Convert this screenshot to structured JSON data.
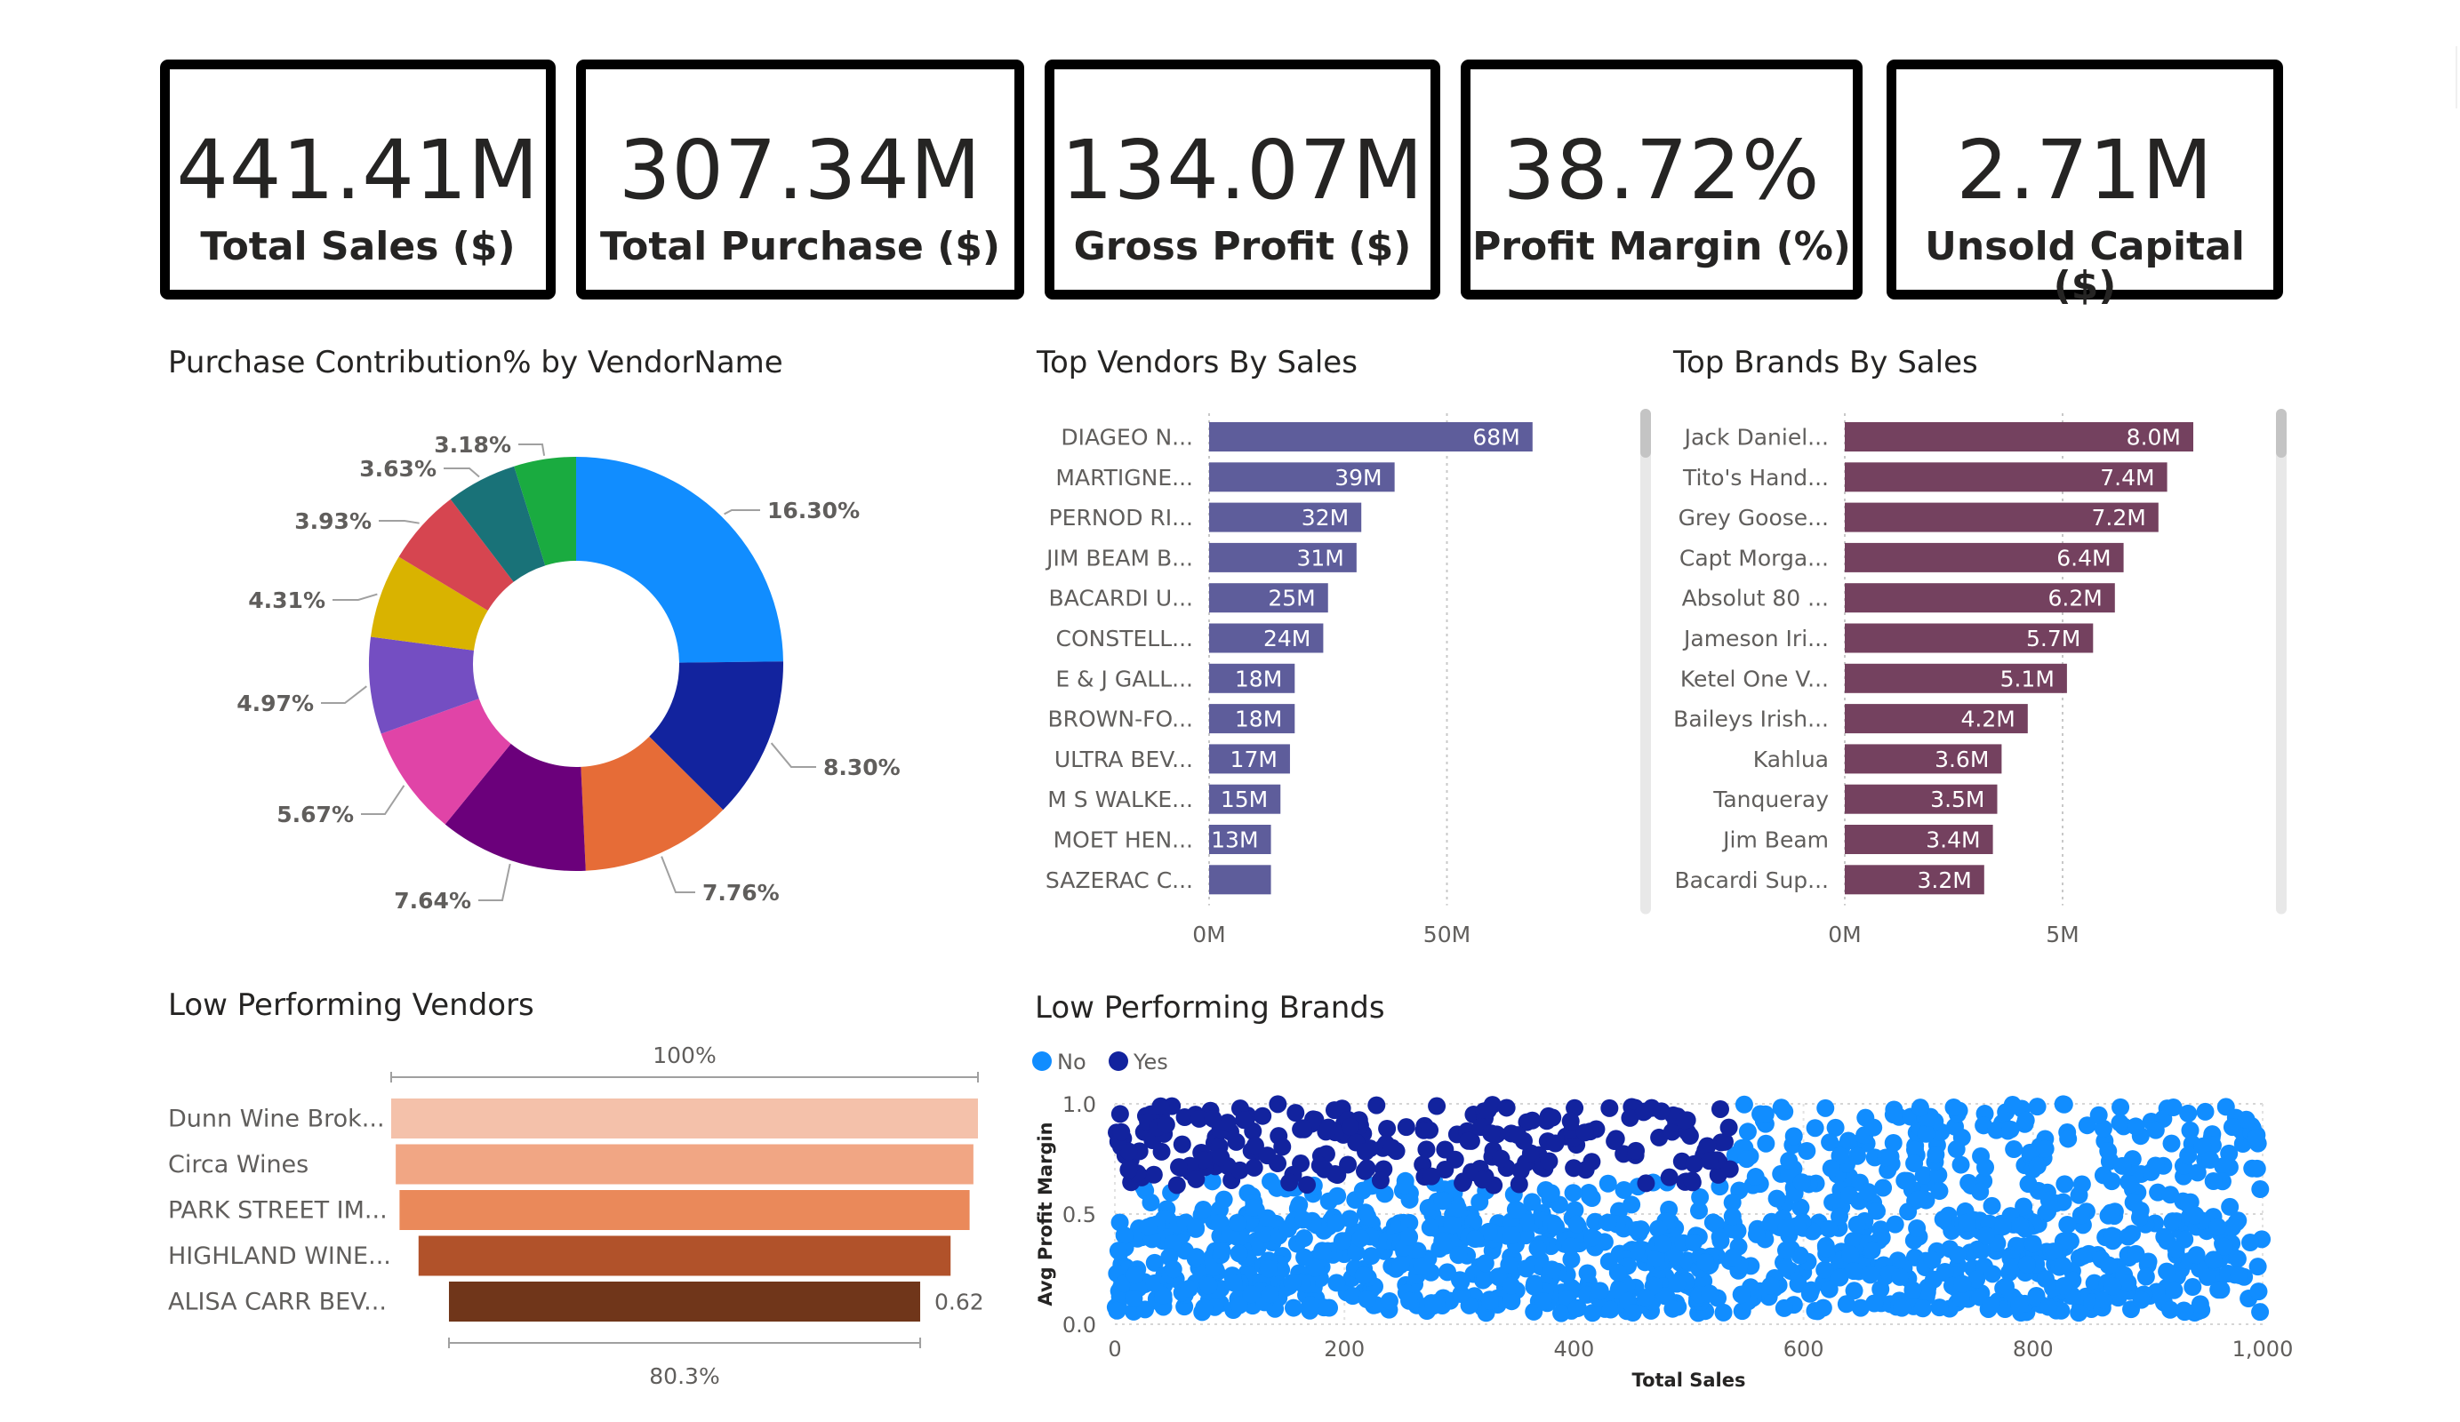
{
  "kpis": [
    {
      "value": "441.41M",
      "label": "Total Sales ($)"
    },
    {
      "value": "307.34M",
      "label": "Total Purchase ($)"
    },
    {
      "value": "134.07M",
      "label": "Gross Profit ($)"
    },
    {
      "value": "38.72%",
      "label": "Profit Margin (%)"
    },
    {
      "value": "2.71M",
      "label": "Unsold Capital ($)"
    }
  ],
  "chart_data": [
    {
      "type": "pie",
      "title": "Purchase Contribution% by VendorName",
      "values": [
        16.3,
        8.3,
        7.76,
        7.64,
        5.67,
        4.97,
        4.31,
        3.93,
        3.63,
        3.18
      ],
      "labels": [
        "16.30%",
        "8.30%",
        "7.76%",
        "7.64%",
        "5.67%",
        "4.97%",
        "4.31%",
        "3.93%",
        "3.63%",
        "3.18%"
      ],
      "colors": [
        "#118DFF",
        "#12239E",
        "#E66C37",
        "#6B007B",
        "#E044A7",
        "#744EC2",
        "#D9B300",
        "#D64550",
        "#197278",
        "#1AAB40"
      ]
    },
    {
      "type": "bar",
      "orientation": "horizontal",
      "title": "Top Vendors By Sales",
      "categories": [
        "DIAGEO N...",
        "MARTIGNE...",
        "PERNOD RI...",
        "JIM BEAM B...",
        "BACARDI U...",
        "CONSTELL...",
        "E & J GALL...",
        "BROWN-FO...",
        "ULTRA BEV...",
        "M S WALKE...",
        "MOET HEN...",
        "SAZERAC C..."
      ],
      "values": [
        68,
        39,
        32,
        31,
        25,
        24,
        18,
        18,
        17,
        15,
        13,
        13
      ],
      "data_labels": [
        "68M",
        "39M",
        "32M",
        "31M",
        "25M",
        "24M",
        "18M",
        "18M",
        "17M",
        "15M",
        "13M",
        ""
      ],
      "x_ticks": [
        "0M",
        "50M"
      ],
      "xlim": [
        0,
        72
      ],
      "color": "#5E5D9B"
    },
    {
      "type": "bar",
      "orientation": "horizontal",
      "title": "Top Brands By Sales",
      "categories": [
        "Jack Daniel...",
        "Tito's Hand...",
        "Grey Goose...",
        "Capt Morga...",
        "Absolut 80 ...",
        "Jameson Iri...",
        "Ketel One V...",
        "Baileys Irish...",
        "Kahlua",
        "Tanqueray",
        "Jim Beam",
        "Bacardi Sup..."
      ],
      "values": [
        8.0,
        7.4,
        7.2,
        6.4,
        6.2,
        5.7,
        5.1,
        4.2,
        3.6,
        3.5,
        3.4,
        3.2
      ],
      "data_labels": [
        "8.0M",
        "7.4M",
        "7.2M",
        "6.4M",
        "6.2M",
        "5.7M",
        "5.1M",
        "4.2M",
        "3.6M",
        "3.5M",
        "3.4M",
        "3.2M"
      ],
      "x_ticks": [
        "0M",
        "5M"
      ],
      "xlim": [
        0,
        9.2
      ],
      "color": "#74415F"
    },
    {
      "type": "bar",
      "subtype": "funnel",
      "title": "Low Performing Vendors",
      "categories": [
        "Dunn Wine Brok...",
        "Circa Wines",
        "PARK STREET IM...",
        "HIGHLAND WINE...",
        "ALISA CARR BEV..."
      ],
      "values": [
        0.772,
        0.76,
        0.75,
        0.7,
        0.62
      ],
      "end_label": "0.62",
      "top_label": "100%",
      "bottom_label": "80.3%",
      "colors": [
        "#F4C1AA",
        "#F1A684",
        "#EA895A",
        "#B1522A",
        "#70361A"
      ]
    },
    {
      "type": "scatter",
      "title": "Low Performing Brands",
      "legend": {
        "placement": "top-left",
        "items": [
          {
            "name": "No",
            "color": "#118DFF"
          },
          {
            "name": "Yes",
            "color": "#12239E"
          }
        ]
      },
      "xlabel": "Total Sales",
      "ylabel": "Avg Profit Margin",
      "xlim": [
        0,
        1000
      ],
      "ylim": [
        0,
        1.0
      ],
      "x_ticks": [
        "0",
        "200",
        "400",
        "600",
        "800",
        "1,000"
      ],
      "y_ticks": [
        "0.0",
        "0.5",
        "1.0"
      ],
      "series": [
        {
          "name": "No",
          "n_points": 1200,
          "x_range": [
            0,
            1000
          ],
          "y_range": [
            0,
            1.0
          ],
          "density": "concentrated 0.1-0.45"
        },
        {
          "name": "Yes",
          "n_points": 230,
          "x_range": [
            0,
            540
          ],
          "y_range": [
            0.63,
            1.0
          ]
        }
      ]
    }
  ]
}
